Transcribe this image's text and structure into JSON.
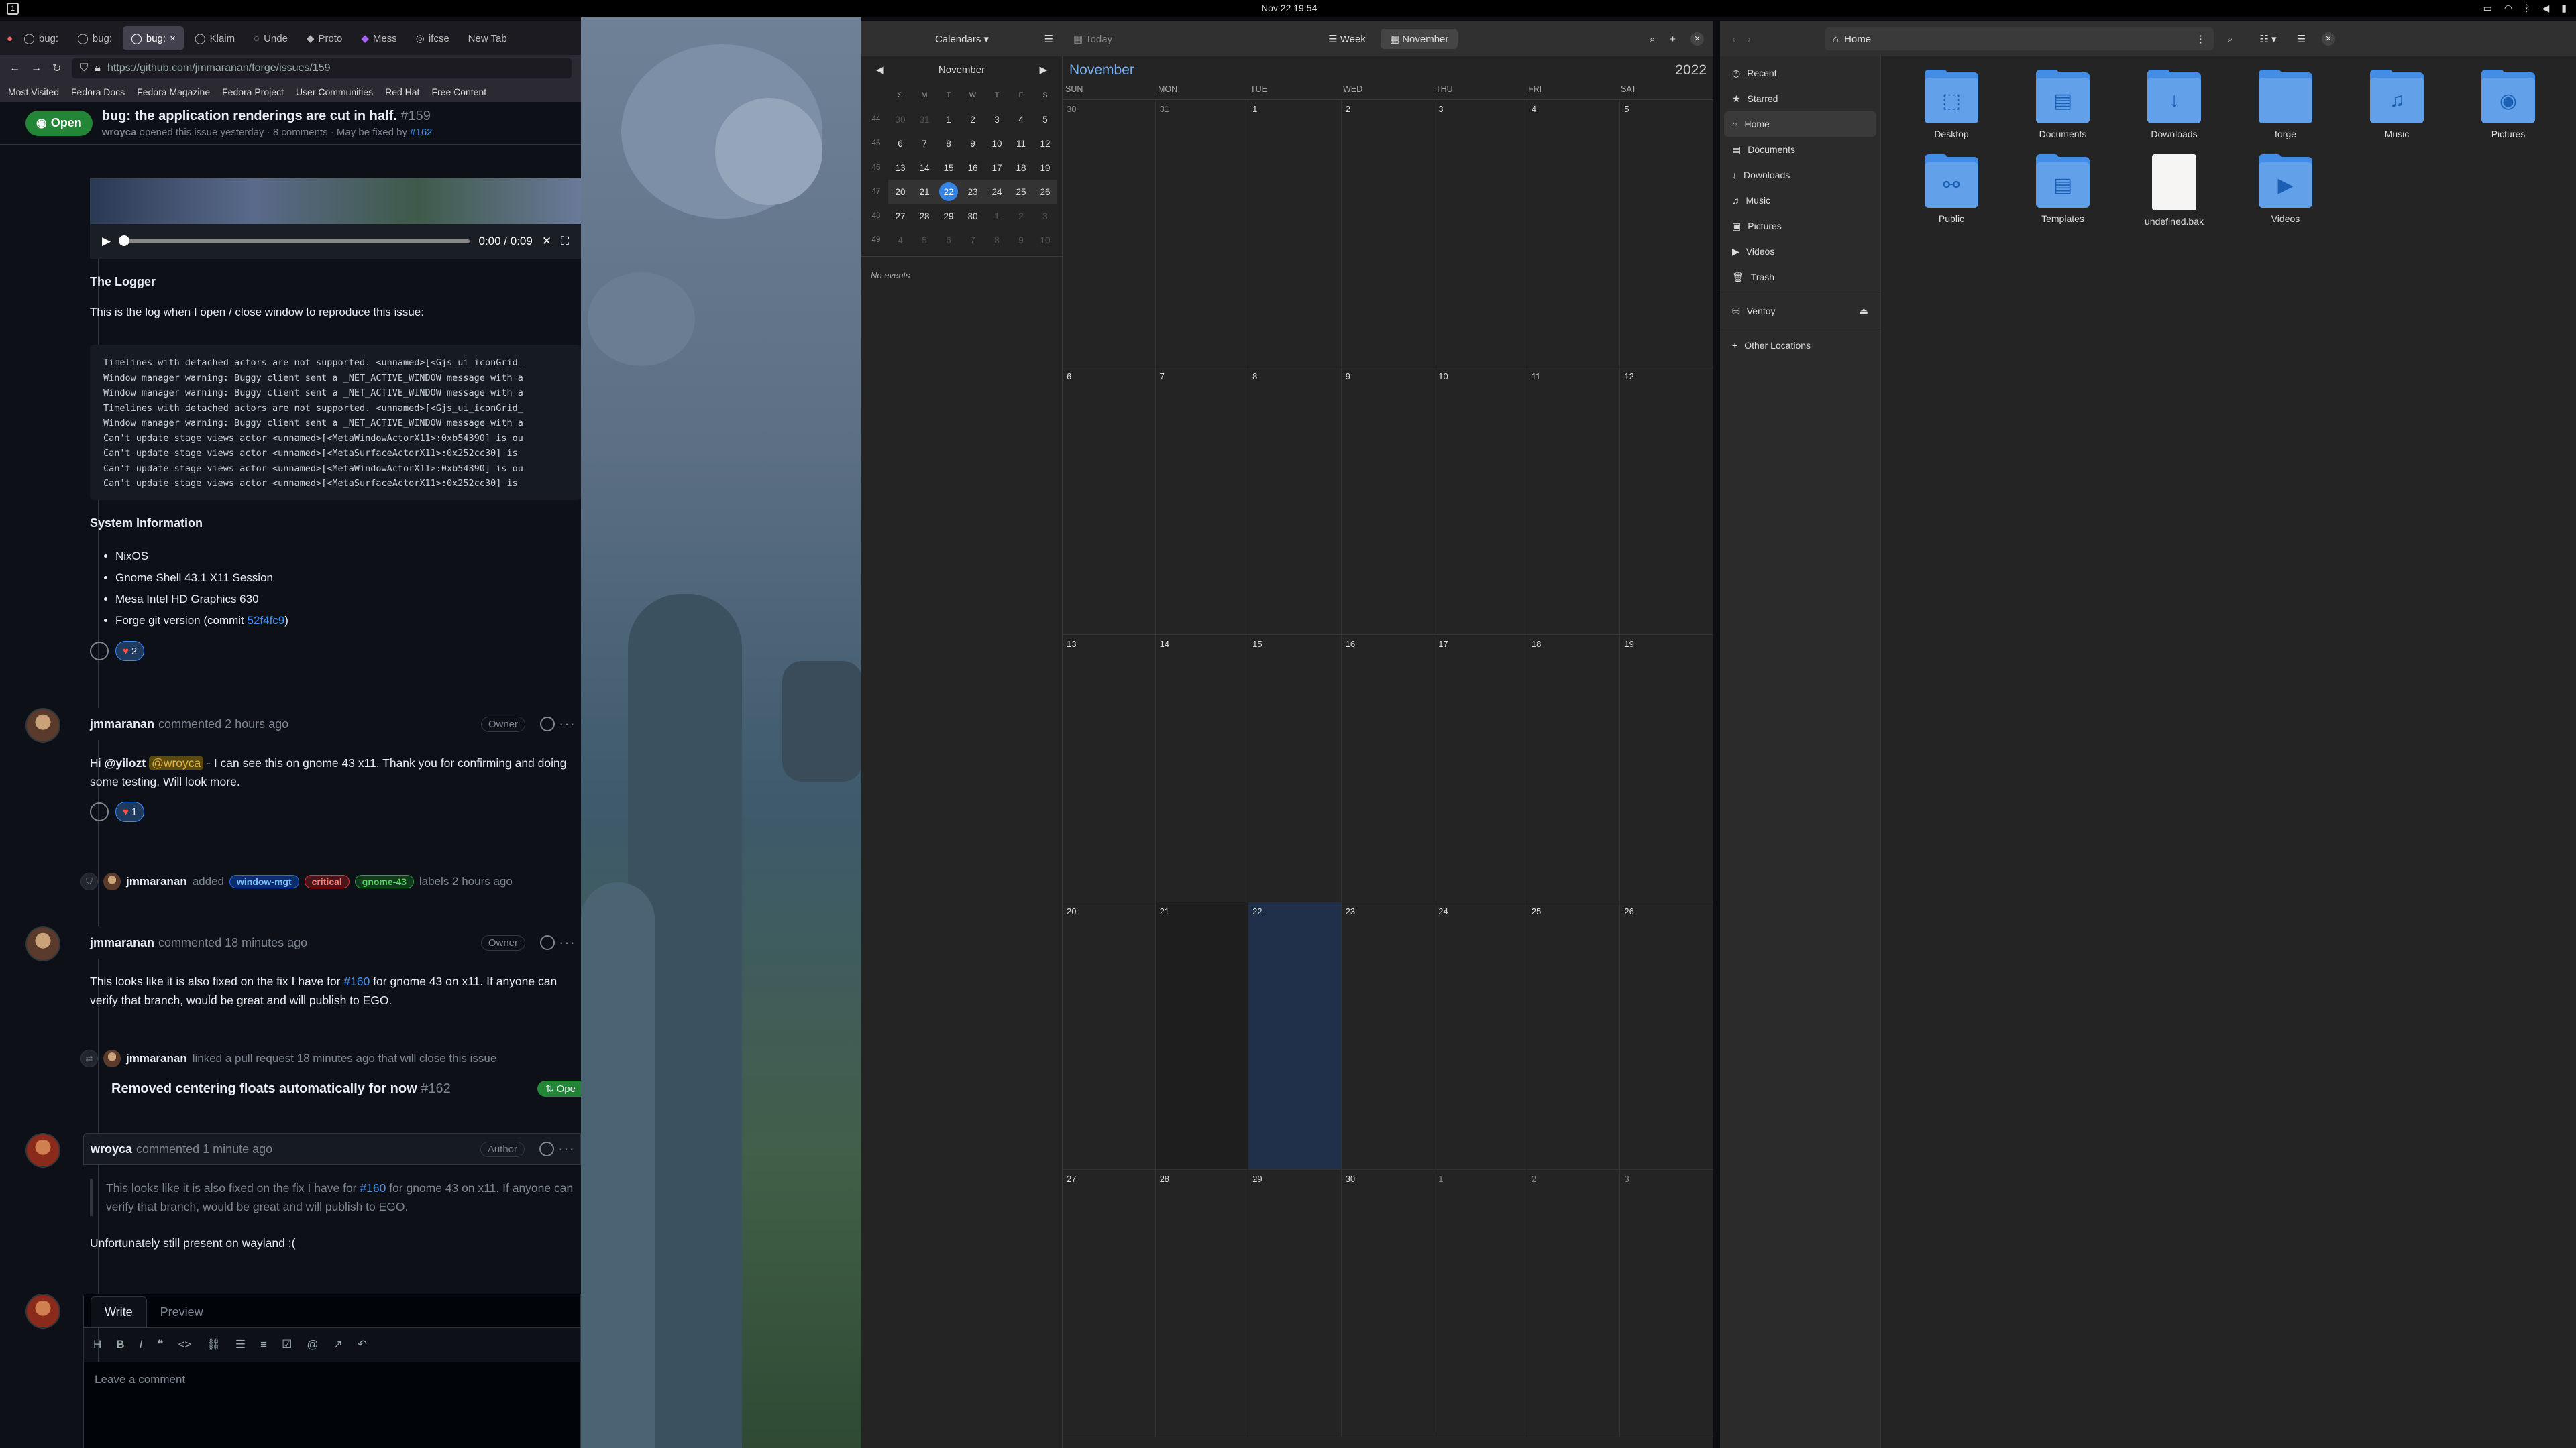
{
  "topbar": {
    "workspace": "1",
    "clock": "Nov 22  19:54"
  },
  "firefox": {
    "tabs": [
      {
        "label": "bug:"
      },
      {
        "label": "bug:"
      },
      {
        "label": "bug:"
      },
      {
        "label": "Klaim"
      },
      {
        "label": "Unde"
      },
      {
        "label": "Proto"
      },
      {
        "label": "Mess"
      },
      {
        "label": "ifcse"
      },
      {
        "label": "New Tab"
      }
    ],
    "url": "https://github.com/jmmaranan/forge/issues/159",
    "bookmarks": [
      "Most Visited",
      "Fedora Docs",
      "Fedora Magazine",
      "Fedora Project",
      "User Communities",
      "Red Hat",
      "Free Content"
    ]
  },
  "issue": {
    "state": "Open",
    "title": "bug: the application renderings are cut in half.",
    "number": "#159",
    "author": "wroyca",
    "sub": "opened this issue yesterday · 8 comments · May be fixed by",
    "fixed_by": "#162",
    "video_time": "0:00 / 0:09",
    "logger_heading": "The Logger",
    "logger_text": "This is the log when I open / close window to reproduce this issue:",
    "log": "Timelines with detached actors are not supported. <unnamed>[<Gjs_ui_iconGrid_\nWindow manager warning: Buggy client sent a _NET_ACTIVE_WINDOW message with a\nWindow manager warning: Buggy client sent a _NET_ACTIVE_WINDOW message with a\nTimelines with detached actors are not supported. <unnamed>[<Gjs_ui_iconGrid_\nWindow manager warning: Buggy client sent a _NET_ACTIVE_WINDOW message with a\nCan't update stage views actor <unnamed>[<MetaWindowActorX11>:0xb54390] is ou\nCan't update stage views actor <unnamed>[<MetaSurfaceActorX11>:0x252cc30] is \nCan't update stage views actor <unnamed>[<MetaWindowActorX11>:0xb54390] is ou\nCan't update stage views actor <unnamed>[<MetaSurfaceActorX11>:0x252cc30] is ",
    "sysinfo_heading": "System Information",
    "sysinfo": [
      "NixOS",
      "Gnome Shell 43.1 X11 Session",
      "Mesa Intel HD Graphics 630"
    ],
    "sysinfo_last": "Forge git version (commit ",
    "commit": "52f4fc9",
    "sysinfo_last_close": ")",
    "reaction1": "2",
    "c1": {
      "author": "jmmaranan",
      "meta": "commented 2 hours ago",
      "role": "Owner",
      "t1": "Hi ",
      "m1": "@yilozt",
      "m2": "@wroyca",
      "t2": " - I can see this on gnome 43 x11. Thank you for confirming and doing some testing. Will look more.",
      "reaction": "1"
    },
    "labels_event": {
      "actor": "jmmaranan",
      "verb": "added",
      "labels": [
        "window-mgt",
        "critical",
        "gnome-43"
      ],
      "suffix": "labels 2 hours ago"
    },
    "c2": {
      "author": "jmmaranan",
      "meta": "commented 18 minutes ago",
      "role": "Owner",
      "t1": "This looks like it is also fixed on the fix I have for ",
      "link": "#160",
      "t2": " for gnome 43 on x11. If anyone can verify that branch, would be great and will publish to EGO."
    },
    "pr_event": {
      "actor": "jmmaranan",
      "text": "linked a pull request 18 minutes ago that will close this issue",
      "pr_title": "Removed centering floats automatically for now",
      "pr_num": "#162",
      "pr_state": "Ope"
    },
    "c3": {
      "author": "wroyca",
      "meta": "commented 1 minute ago",
      "role": "Author",
      "q1": "This looks like it is also fixed on the fix I have for ",
      "qlink": "#160",
      "q2": " for gnome 43 on x11. If anyone can verify that branch, would be great and will publish to EGO.",
      "text": "Unfortunately still present on wayland :("
    },
    "editor": {
      "write": "Write",
      "preview": "Preview",
      "placeholder": "Leave a comment"
    }
  },
  "calendar": {
    "menu": "Calendars",
    "today": "Today",
    "week": "Week",
    "month": "November",
    "mini_month": "November",
    "mini_dow": [
      "S",
      "M",
      "T",
      "W",
      "T",
      "F",
      "S"
    ],
    "mini_rows": [
      {
        "wk": "44",
        "days": [
          "30",
          "31",
          "1",
          "2",
          "3",
          "4",
          "5"
        ]
      },
      {
        "wk": "45",
        "days": [
          "6",
          "7",
          "8",
          "9",
          "10",
          "11",
          "12"
        ]
      },
      {
        "wk": "46",
        "days": [
          "13",
          "14",
          "15",
          "16",
          "17",
          "18",
          "19"
        ]
      },
      {
        "wk": "47",
        "days": [
          "20",
          "21",
          "22",
          "23",
          "24",
          "25",
          "26"
        ]
      },
      {
        "wk": "48",
        "days": [
          "27",
          "28",
          "29",
          "30",
          "1",
          "2",
          "3"
        ]
      },
      {
        "wk": "49",
        "days": [
          "4",
          "5",
          "6",
          "7",
          "8",
          "9",
          "10"
        ]
      }
    ],
    "no_events": "No events",
    "year": "2022",
    "dow": [
      "SUN",
      "MON",
      "TUE",
      "WED",
      "THU",
      "FRI",
      "SAT"
    ],
    "weeks": [
      [
        "30",
        "31",
        "1",
        "2",
        "3",
        "4",
        "5"
      ],
      [
        "6",
        "7",
        "8",
        "9",
        "10",
        "11",
        "12"
      ],
      [
        "13",
        "14",
        "15",
        "16",
        "17",
        "18",
        "19"
      ],
      [
        "20",
        "21",
        "22",
        "23",
        "24",
        "25",
        "26"
      ],
      [
        "27",
        "28",
        "29",
        "30",
        "1",
        "2",
        "3"
      ]
    ],
    "today_date": "22"
  },
  "files": {
    "path": "Home",
    "sidebar": [
      "Recent",
      "Starred",
      "Home",
      "Documents",
      "Downloads",
      "Music",
      "Pictures",
      "Videos",
      "Trash"
    ],
    "ventoy": "Ventoy",
    "other": "Other Locations",
    "items": [
      {
        "name": "Desktop",
        "icon": "⬚"
      },
      {
        "name": "Documents",
        "icon": "▤"
      },
      {
        "name": "Downloads",
        "icon": "↓"
      },
      {
        "name": "forge",
        "icon": ""
      },
      {
        "name": "Music",
        "icon": "♫"
      },
      {
        "name": "Pictures",
        "icon": "◉"
      },
      {
        "name": "Public",
        "icon": "⚯"
      },
      {
        "name": "Templates",
        "icon": "▤"
      },
      {
        "name": "undefined.bak",
        "icon": "file"
      },
      {
        "name": "Videos",
        "icon": "▶"
      }
    ]
  }
}
